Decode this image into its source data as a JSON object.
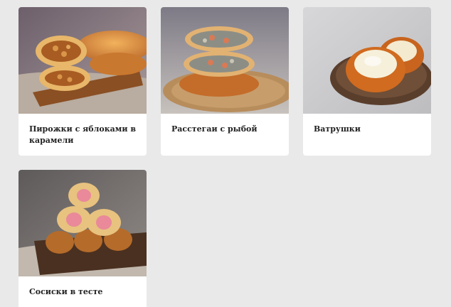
{
  "products": [
    {
      "title": "Пирожки с яблоками в карамели",
      "image_icon": "apple-pies-photo"
    },
    {
      "title": "Расстегаи с рыбой",
      "image_icon": "fish-rasstegai-photo"
    },
    {
      "title": "Ватрушки",
      "image_icon": "vatrushki-photo"
    },
    {
      "title": "Сосиски в тесте",
      "image_icon": "sausage-rolls-photo"
    }
  ],
  "colors": {
    "page_bg": "#e9e9e9",
    "card_bg": "#ffffff",
    "text": "#222222",
    "crust": "#d98a3a"
  }
}
